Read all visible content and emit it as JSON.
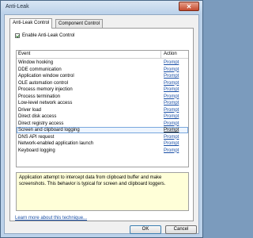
{
  "window": {
    "title": "Anti-Leak",
    "close_glyph": "✕"
  },
  "tabs": [
    {
      "label": "Anti-Leak Control",
      "active": true
    },
    {
      "label": "Component Control",
      "active": false
    }
  ],
  "enable_checkbox": {
    "label": "Enable Anti-Leak Control",
    "checked": true
  },
  "list": {
    "columns": {
      "event": "Event",
      "action": "Action"
    },
    "rows": [
      {
        "event": "Window hooking",
        "action": "Prompt"
      },
      {
        "event": "DDE communication",
        "action": "Prompt"
      },
      {
        "event": "Application window control",
        "action": "Prompt"
      },
      {
        "event": "OLE automation control",
        "action": "Prompt"
      },
      {
        "event": "Process memory injection",
        "action": "Prompt"
      },
      {
        "event": "Process termination",
        "action": "Prompt"
      },
      {
        "event": "Low-level network access",
        "action": "Prompt"
      },
      {
        "event": "Driver load",
        "action": "Prompt"
      },
      {
        "event": "Direct disk access",
        "action": "Prompt"
      },
      {
        "event": "Direct registry access",
        "action": "Prompt"
      },
      {
        "event": "Screen and clipboard logging",
        "action": "Prompt",
        "selected": true
      },
      {
        "event": "DNS API request",
        "action": "Prompt"
      },
      {
        "event": "Network-enabled application launch",
        "action": "Prompt"
      },
      {
        "event": "Keyboard logging",
        "action": "Prompt"
      }
    ]
  },
  "description": "Application attempt to intercept data from clipboard buffer and make screenshots. This behavior is typical for screen and clipboard loggers.",
  "learn_more": "Learn more about this technique...",
  "buttons": {
    "ok": "OK",
    "cancel": "Cancel"
  },
  "colors": {
    "link": "#1a4fa6",
    "description_bg": "#ffffd8",
    "selected_row_border": "#79a7dd"
  }
}
